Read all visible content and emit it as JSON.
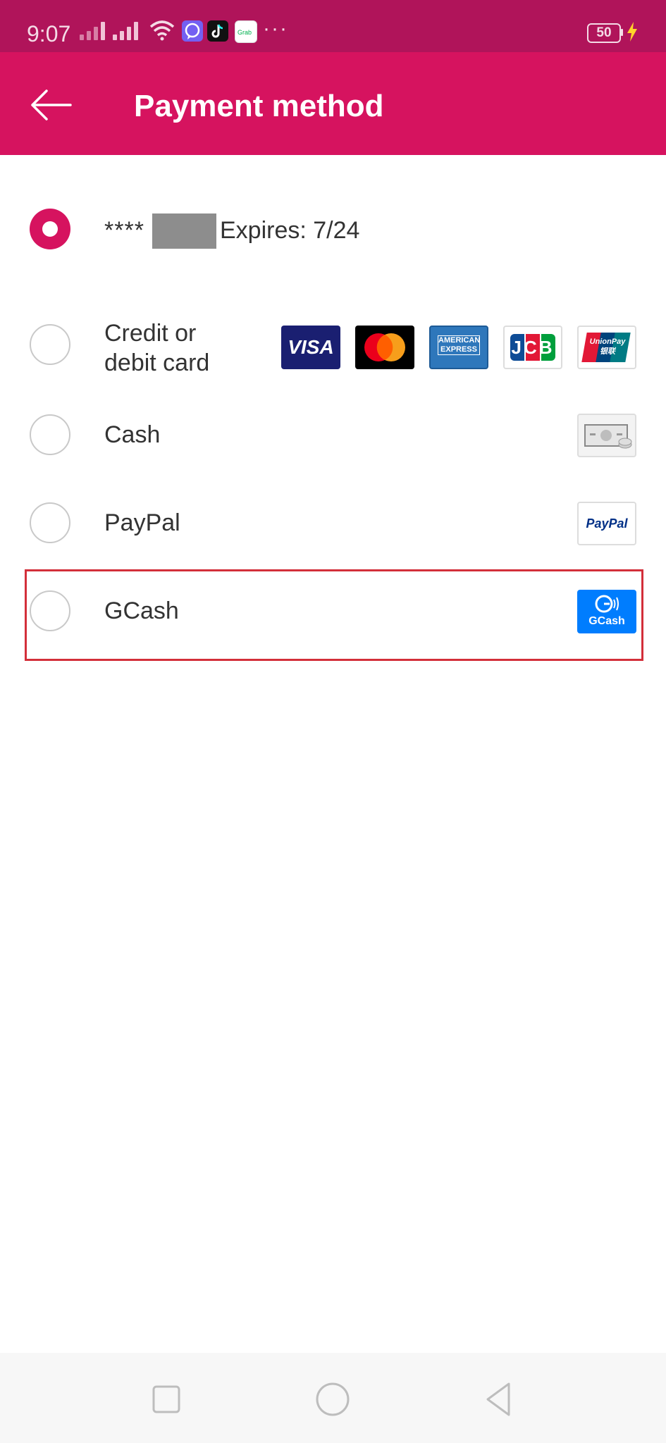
{
  "status_bar": {
    "time": "9:07",
    "battery": "50",
    "more": "···",
    "icons": [
      "signal-icon",
      "signal-icon",
      "wifi-icon",
      "viber-icon",
      "tiktok-icon",
      "grab-icon",
      "bolt-icon"
    ]
  },
  "header": {
    "title": "Payment method",
    "back_icon": "arrow-left-icon"
  },
  "saved_card": {
    "masked_prefix": "****",
    "expires": "Expires: 7/24",
    "selected": true
  },
  "options": [
    {
      "label_line1": "Credit or",
      "label_line2": "debit card",
      "logos": [
        {
          "name": "visa",
          "text": "VISA"
        },
        {
          "name": "mastercard",
          "text": ""
        },
        {
          "name": "american-express",
          "text_line1": "AMERICAN",
          "text_line2": "EXPRESS"
        },
        {
          "name": "jcb",
          "text": "JCB"
        },
        {
          "name": "unionpay",
          "text_line1": "UnionPay",
          "text_line2": "银联"
        }
      ]
    },
    {
      "label": "Cash",
      "logo": "cash-icon"
    },
    {
      "label": "PayPal",
      "logo_text": "PayPal"
    },
    {
      "label": "GCash",
      "logo_text": "GCash",
      "highlighted": true
    }
  ],
  "colors": {
    "accent": "#d6135f",
    "status_bar": "#b0145a",
    "highlight": "#d32f3a"
  },
  "nav": {
    "icons": [
      "square-icon",
      "circle-icon",
      "triangle-back-icon"
    ]
  }
}
